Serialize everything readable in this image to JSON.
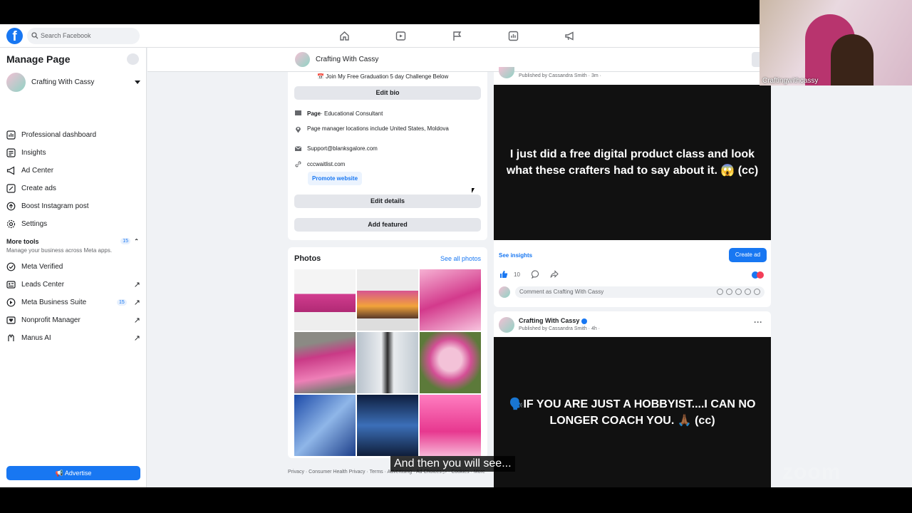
{
  "search": {
    "placeholder": "Search Facebook"
  },
  "sidebar": {
    "title": "Manage Page",
    "page_name": "Crafting With Cassy",
    "items": [
      {
        "label": "Professional dashboard",
        "icon": "dashboard-icon"
      },
      {
        "label": "Insights",
        "icon": "insights-icon"
      },
      {
        "label": "Ad Center",
        "icon": "megaphone-icon"
      },
      {
        "label": "Create ads",
        "icon": "pencil-icon"
      },
      {
        "label": "Boost Instagram post",
        "icon": "instagram-icon"
      },
      {
        "label": "Settings",
        "icon": "gear-icon"
      }
    ],
    "more_tools": {
      "label": "More tools",
      "badge": "15",
      "subtitle": "Manage your business across Meta apps."
    },
    "tools": [
      {
        "label": "Meta Verified",
        "badge": "",
        "arrow": ""
      },
      {
        "label": "Leads Center",
        "badge": "",
        "arrow": "↗"
      },
      {
        "label": "Meta Business Suite",
        "badge": "15",
        "arrow": "↗"
      },
      {
        "label": "Nonprofit Manager",
        "badge": "",
        "arrow": "↗"
      },
      {
        "label": "Manus AI",
        "badge": "",
        "arrow": "↗"
      }
    ],
    "advertise": "Advertise"
  },
  "pagebar": {
    "name": "Crafting With Cassy"
  },
  "intro": {
    "challenge": "📅 Join My Free Graduation 5 day Challenge Below",
    "edit_bio": "Edit bio",
    "category_bold": "Page",
    "category": " · Educational Consultant",
    "locations": "Page manager locations include United States, Moldova",
    "email": "Support@blanksgalore.com",
    "website": "cccwaitlist.com",
    "promote": "Promote website",
    "edit_details": "Edit details",
    "add_featured": "Add featured"
  },
  "photos": {
    "title": "Photos",
    "see_all": "See all photos"
  },
  "footer": {
    "text": "Privacy · Consumer Health Privacy · Terms · Advertising · Ad Choices ▷ · Cookies · More"
  },
  "post1": {
    "published": "Published by Cassandra Smith",
    "time": "· 3m ·",
    "text": "I just did a free digital product class and look what these crafters had to say about it. 😱 (cc)",
    "see_insights": "See insights",
    "create_ad": "Create ad",
    "likes": "10",
    "comment_placeholder": "Comment as Crafting With Cassy"
  },
  "post2": {
    "author": "Crafting With Cassy",
    "published": "Published by Cassandra Smith",
    "time": "· 4h ·",
    "text": "🗣️IF YOU ARE JUST A HOBBYIST....I CAN NO LONGER COACH YOU. 🙏🏾 (cc)"
  },
  "video": {
    "name": "Craftingwithcassy"
  },
  "caption": "And then you will see...",
  "watermark": "zoom",
  "colors": {
    "accent": "#1877f2",
    "background": "#f0f2f5"
  }
}
